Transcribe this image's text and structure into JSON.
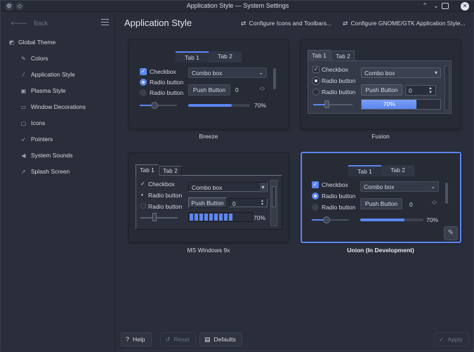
{
  "window": {
    "title": "Application Style — System Settings",
    "minimize": "⌄",
    "maximize": "⌃",
    "restore": "▢",
    "close": "✕"
  },
  "sidebar": {
    "back_label": "Back",
    "items": [
      {
        "label": "Global Theme",
        "icon": "global-theme-icon"
      },
      {
        "label": "Colors",
        "icon": "colors-icon"
      },
      {
        "label": "Application Style",
        "icon": "brush-icon"
      },
      {
        "label": "Plasma Style",
        "icon": "plasma-icon"
      },
      {
        "label": "Window Decorations",
        "icon": "window-icon"
      },
      {
        "label": "Icons",
        "icon": "icons-icon"
      },
      {
        "label": "Pointers",
        "icon": "pointer-icon"
      },
      {
        "label": "System Sounds",
        "icon": "speaker-icon"
      },
      {
        "label": "Splash Screen",
        "icon": "rocket-icon"
      }
    ]
  },
  "header": {
    "title": "Application Style",
    "configure_icons": "Configure Icons and Toolbars...",
    "configure_gtk": "Configure GNOME/GTK Application Style..."
  },
  "preview": {
    "tab1": "Tab 1",
    "tab2": "Tab 2",
    "checkbox": "Checkbox",
    "radio": "Radio button",
    "combo": "Combo box",
    "push": "Push Button",
    "spin": "0",
    "progress_label": "70%",
    "progress": 0.7
  },
  "styles": [
    {
      "name": "Breeze"
    },
    {
      "name": "Fusion"
    },
    {
      "name": "MS Windows 9x"
    },
    {
      "name": "Union (In Development)"
    }
  ],
  "footer": {
    "help": "Help",
    "reset": "Reset",
    "defaults": "Defaults",
    "apply": "Apply"
  },
  "colors": {
    "accent": "#5c86f0",
    "window_bg": "#2a2e3a",
    "card_bg": "#272b36"
  }
}
